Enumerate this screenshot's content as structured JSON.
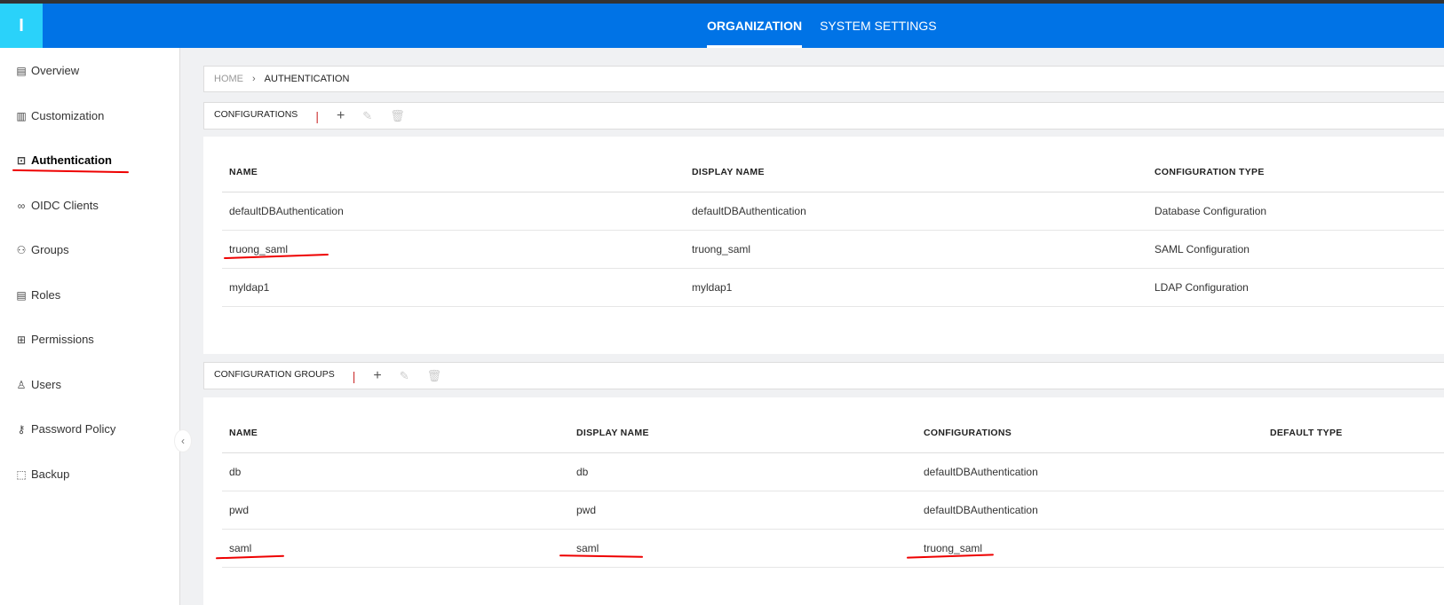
{
  "header": {
    "logo": "I",
    "tabs": [
      {
        "label": "ORGANIZATION"
      },
      {
        "label": "SYSTEM SETTINGS"
      }
    ]
  },
  "sidebar": {
    "items": [
      {
        "label": "Overview",
        "icon": "overview-icon"
      },
      {
        "label": "Customization",
        "icon": "building-icon"
      },
      {
        "label": "Authentication",
        "icon": "ticket-icon"
      },
      {
        "label": "OIDC Clients",
        "icon": "link-icon"
      },
      {
        "label": "Groups",
        "icon": "group-icon"
      },
      {
        "label": "Roles",
        "icon": "roles-icon"
      },
      {
        "label": "Permissions",
        "icon": "grid-icon"
      },
      {
        "label": "Users",
        "icon": "user-icon"
      },
      {
        "label": "Password Policy",
        "icon": "key-icon"
      },
      {
        "label": "Backup",
        "icon": "backup-icon"
      }
    ]
  },
  "breadcrumb": {
    "home": "HOME",
    "current": "AUTHENTICATION"
  },
  "configurations": {
    "title": "CONFIGURATIONS",
    "columns": [
      "NAME",
      "DISPLAY NAME",
      "CONFIGURATION TYPE"
    ],
    "rows": [
      [
        "defaultDBAuthentication",
        "defaultDBAuthentication",
        "Database Configuration"
      ],
      [
        "truong_saml",
        "truong_saml",
        "SAML Configuration"
      ],
      [
        "myldap1",
        "myldap1",
        "LDAP Configuration"
      ]
    ]
  },
  "groups": {
    "title": "CONFIGURATION GROUPS",
    "columns": [
      "NAME",
      "DISPLAY NAME",
      "CONFIGURATIONS",
      "DEFAULT TYPE"
    ],
    "rows": [
      [
        "db",
        "db",
        "defaultDBAuthentication",
        ""
      ],
      [
        "pwd",
        "pwd",
        "defaultDBAuthentication",
        ""
      ],
      [
        "saml",
        "saml",
        "truong_saml",
        ""
      ]
    ]
  }
}
